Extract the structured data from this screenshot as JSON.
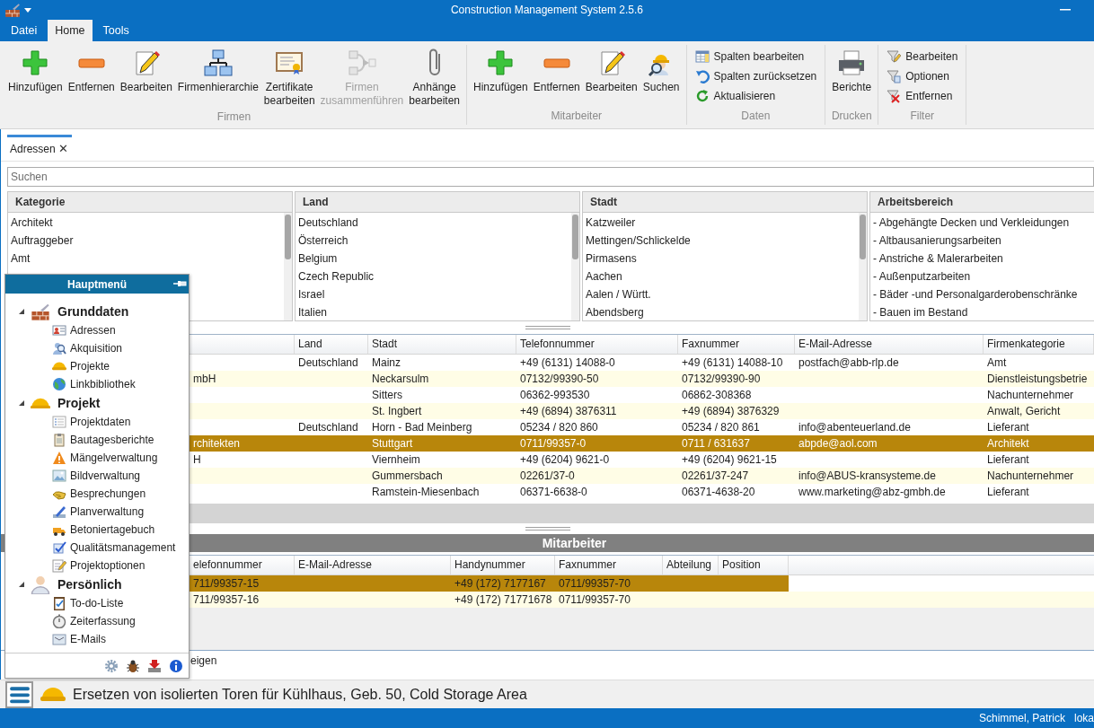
{
  "window": {
    "title": "Construction Management System 2.5.6"
  },
  "menu_tabs": [
    {
      "label": "Datei",
      "selected": false
    },
    {
      "label": "Home",
      "selected": true
    },
    {
      "label": "Tools",
      "selected": false
    }
  ],
  "ribbon": {
    "groups": [
      {
        "label": "Firmen",
        "items": [
          {
            "kind": "large",
            "label": "Hinzufügen",
            "disabled": false
          },
          {
            "kind": "large",
            "label": "Entfernen",
            "disabled": false
          },
          {
            "kind": "large",
            "label": "Bearbeiten",
            "disabled": false
          },
          {
            "kind": "large",
            "label": "Firmenhierarchie",
            "disabled": false
          },
          {
            "kind": "large",
            "label": "Zertifikate bearbeiten",
            "disabled": false
          },
          {
            "kind": "large",
            "label": "Firmen zusammenführen",
            "disabled": true
          },
          {
            "kind": "large",
            "label": "Anhänge bearbeiten",
            "disabled": false
          }
        ]
      },
      {
        "label": "Mitarbeiter",
        "items": [
          {
            "kind": "large",
            "label": "Hinzufügen",
            "disabled": false
          },
          {
            "kind": "large",
            "label": "Entfernen",
            "disabled": false
          },
          {
            "kind": "large",
            "label": "Bearbeiten",
            "disabled": false
          },
          {
            "kind": "large",
            "label": "Suchen",
            "disabled": false
          }
        ]
      },
      {
        "label": "Daten",
        "items": [
          {
            "kind": "small",
            "label": "Spalten bearbeiten",
            "disabled": false
          },
          {
            "kind": "small",
            "label": "Spalten zurücksetzen",
            "disabled": false
          },
          {
            "kind": "small",
            "label": "Aktualisieren",
            "disabled": false
          }
        ]
      },
      {
        "label": "Drucken",
        "items": [
          {
            "kind": "large",
            "label": "Berichte",
            "disabled": false
          }
        ]
      },
      {
        "label": "Filter",
        "items": [
          {
            "kind": "small",
            "label": "Bearbeiten",
            "disabled": false
          },
          {
            "kind": "small",
            "label": "Optionen",
            "disabled": false
          },
          {
            "kind": "small",
            "label": "Entfernen",
            "disabled": false
          }
        ]
      }
    ]
  },
  "document_tabs": [
    {
      "label": "Adressen",
      "close": "✕",
      "selected": true
    }
  ],
  "search": {
    "placeholder": "Suchen"
  },
  "filters": [
    {
      "title": "Kategorie",
      "items": [
        "Architekt",
        "Auftraggeber",
        "Amt"
      ]
    },
    {
      "title": "Land",
      "items": [
        "Deutschland",
        "Österreich",
        "Belgium",
        "Czech Republic",
        "Israel",
        "Italien"
      ]
    },
    {
      "title": "Stadt",
      "items": [
        "Katzweiler",
        "Mettingen/Schlickelde",
        "Pirmasens",
        "Aachen",
        "Aalen / Württ.",
        "Abendsberg"
      ]
    },
    {
      "title": "Arbeitsbereich",
      "items": [
        "- Abgehängte Decken und Verkleidungen",
        "- Altbausanierungsarbeiten",
        "- Anstriche & Malerarbeiten",
        "- Außenputzarbeiten",
        "- Bäder -und Personalgarderobenschränke",
        "- Bauen im Bestand"
      ]
    }
  ],
  "companies": {
    "columns": [
      null,
      "Land",
      "Stadt",
      "Telefonnummer",
      "Faxnummer",
      "E-Mail-Adresse",
      "Firmenkategorie"
    ],
    "rows": [
      {
        "selected": false,
        "cells": [
          null,
          "Deutschland",
          "Mainz",
          "+49 (6131) 14088-0",
          "+49 (6131) 14088-10",
          "postfach@abb-rlp.de",
          "Amt"
        ]
      },
      {
        "selected": false,
        "cells": [
          "mbH",
          null,
          "Neckarsulm",
          "07132/99390-50",
          "07132/99390-90",
          null,
          "Dienstleistungsbetrie"
        ]
      },
      {
        "selected": false,
        "cells": [
          null,
          null,
          "Sitters",
          "06362-993530",
          "06862-308368",
          null,
          "Nachunternehmer"
        ]
      },
      {
        "selected": false,
        "cells": [
          null,
          null,
          "St. Ingbert",
          "+49 (6894) 3876311",
          "+49 (6894) 3876329",
          null,
          "Anwalt, Gericht"
        ]
      },
      {
        "selected": false,
        "cells": [
          null,
          "Deutschland",
          "Horn - Bad Meinberg",
          "05234 / 820 860",
          "05234 / 820 861",
          "info@abenteuerland.de",
          "Lieferant"
        ]
      },
      {
        "selected": true,
        "cells": [
          "rchitekten",
          null,
          "Stuttgart",
          "0711/99357-0",
          "0711 / 631637",
          "abpde@aol.com",
          "Architekt"
        ]
      },
      {
        "selected": false,
        "cells": [
          "H",
          null,
          "Viernheim",
          "+49 (6204) 9621-0",
          "+49 (6204) 9621-15",
          null,
          "Lieferant"
        ]
      },
      {
        "selected": false,
        "cells": [
          null,
          null,
          "Gummersbach",
          "02261/37-0",
          "02261/37-247",
          "info@ABUS-kransysteme.de",
          "Nachunternehmer"
        ]
      },
      {
        "selected": false,
        "cells": [
          null,
          null,
          "Ramstein-Miesenbach",
          "06371-6638-0",
          "06371-4638-20",
          "www.marketing@abz-gmbh.de",
          "Lieferant"
        ]
      }
    ]
  },
  "employees": {
    "title": "Mitarbeiter",
    "columns": [
      "elefonnummer",
      "E-Mail-Adresse",
      "Handynummer",
      "Faxnummer",
      "Abteilung",
      "Position"
    ],
    "rows": [
      {
        "selected": true,
        "cells": [
          "711/99357-15",
          null,
          "+49 (172) 7177167",
          "0711/99357-70",
          null,
          null
        ]
      },
      {
        "selected": false,
        "cells": [
          "711/99357-16",
          null,
          "+49 (172) 71771678",
          "0711/99357-70",
          null,
          null
        ]
      }
    ]
  },
  "footer_text": "eigen",
  "main_menu": {
    "title": "Hauptmenü",
    "tree": [
      {
        "label": "Grunddaten",
        "expanded": true,
        "children": [
          {
            "label": "Adressen"
          },
          {
            "label": "Akquisition"
          },
          {
            "label": "Projekte"
          },
          {
            "label": "Linkbibliothek"
          }
        ]
      },
      {
        "label": "Projekt",
        "expanded": true,
        "children": [
          {
            "label": "Projektdaten"
          },
          {
            "label": "Bautagesberichte"
          },
          {
            "label": "Mängelverwaltung"
          },
          {
            "label": "Bildverwaltung"
          },
          {
            "label": "Besprechungen"
          },
          {
            "label": "Planverwaltung"
          },
          {
            "label": "Betoniertagebuch"
          },
          {
            "label": "Qualitätsmanagement"
          },
          {
            "label": "Projektoptionen"
          }
        ]
      },
      {
        "label": "Persönlich",
        "expanded": true,
        "children": [
          {
            "label": "To-do-Liste"
          },
          {
            "label": "Zeiterfassung"
          },
          {
            "label": "E-Mails"
          }
        ]
      }
    ]
  },
  "project_bar": {
    "project": "Ersetzen von isolierten Toren für Kühlhaus, Geb. 50, Cold Storage Area"
  },
  "status_bar": {
    "user": "Schimmel, Patrick",
    "location": "loka"
  }
}
